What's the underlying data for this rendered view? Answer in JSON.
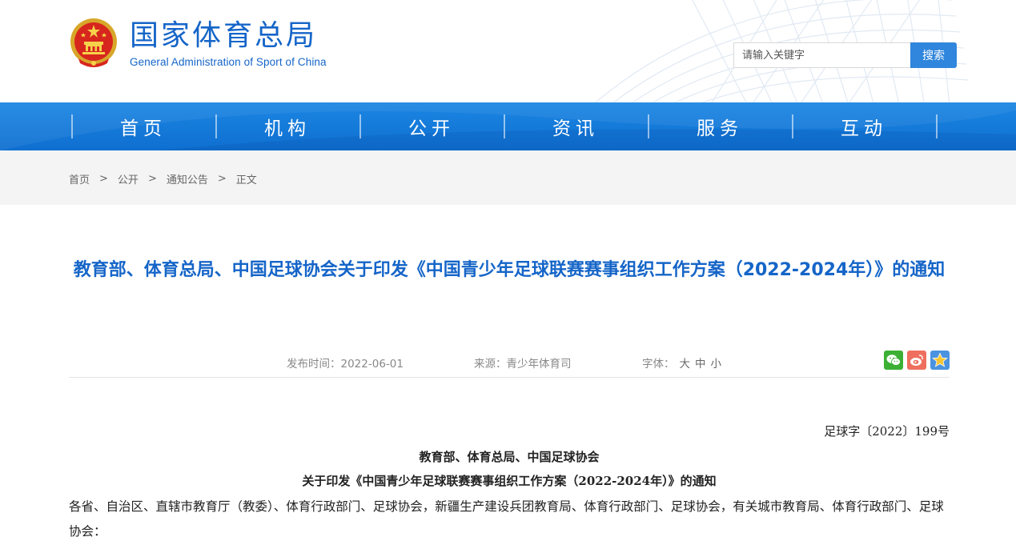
{
  "site": {
    "name_cn": "国家体育总局",
    "name_en": "General Administration of Sport of China"
  },
  "search": {
    "placeholder": "请输入关键字",
    "button": "搜索"
  },
  "nav": {
    "items": [
      {
        "label": "首页"
      },
      {
        "label": "机构"
      },
      {
        "label": "公开"
      },
      {
        "label": "资讯"
      },
      {
        "label": "服务"
      },
      {
        "label": "互动"
      }
    ]
  },
  "breadcrumb": {
    "items": [
      "首页",
      "公开",
      "通知公告",
      "正文"
    ],
    "separator": ">"
  },
  "article": {
    "title": "教育部、体育总局、中国足球协会关于印发《中国青少年足球联赛赛事组织工作方案（2022-2024年）》的通知",
    "publish_label": "发布时间：",
    "publish_date": "2022-06-01",
    "source_label": "来源：",
    "source": "青少年体育司",
    "font_label": "字体：",
    "font_large": "大",
    "font_medium": "中",
    "font_small": "小",
    "doc_number": "足球字〔2022〕199号",
    "issuers": "教育部、体育总局、中国足球协会",
    "subtitle": "关于印发《中国青少年足球联赛赛事组织工作方案（2022-2024年）》的通知",
    "body": "各省、自治区、直辖市教育厅（教委）、体育行政部门、足球协会，新疆生产建设兵团教育局、体育行政部门、足球协会，有关城市教育局、体育行政部门、足球协会："
  },
  "colors": {
    "brand_blue": "#1565c8",
    "nav_blue": "#1b86e3",
    "search_button": "#2f86dc",
    "breadcrumb_bg": "#f4f4f4"
  },
  "icons": {
    "emblem": "national-emblem-icon",
    "wechat": "wechat-icon",
    "weibo": "weibo-icon",
    "favorite": "star-icon"
  }
}
